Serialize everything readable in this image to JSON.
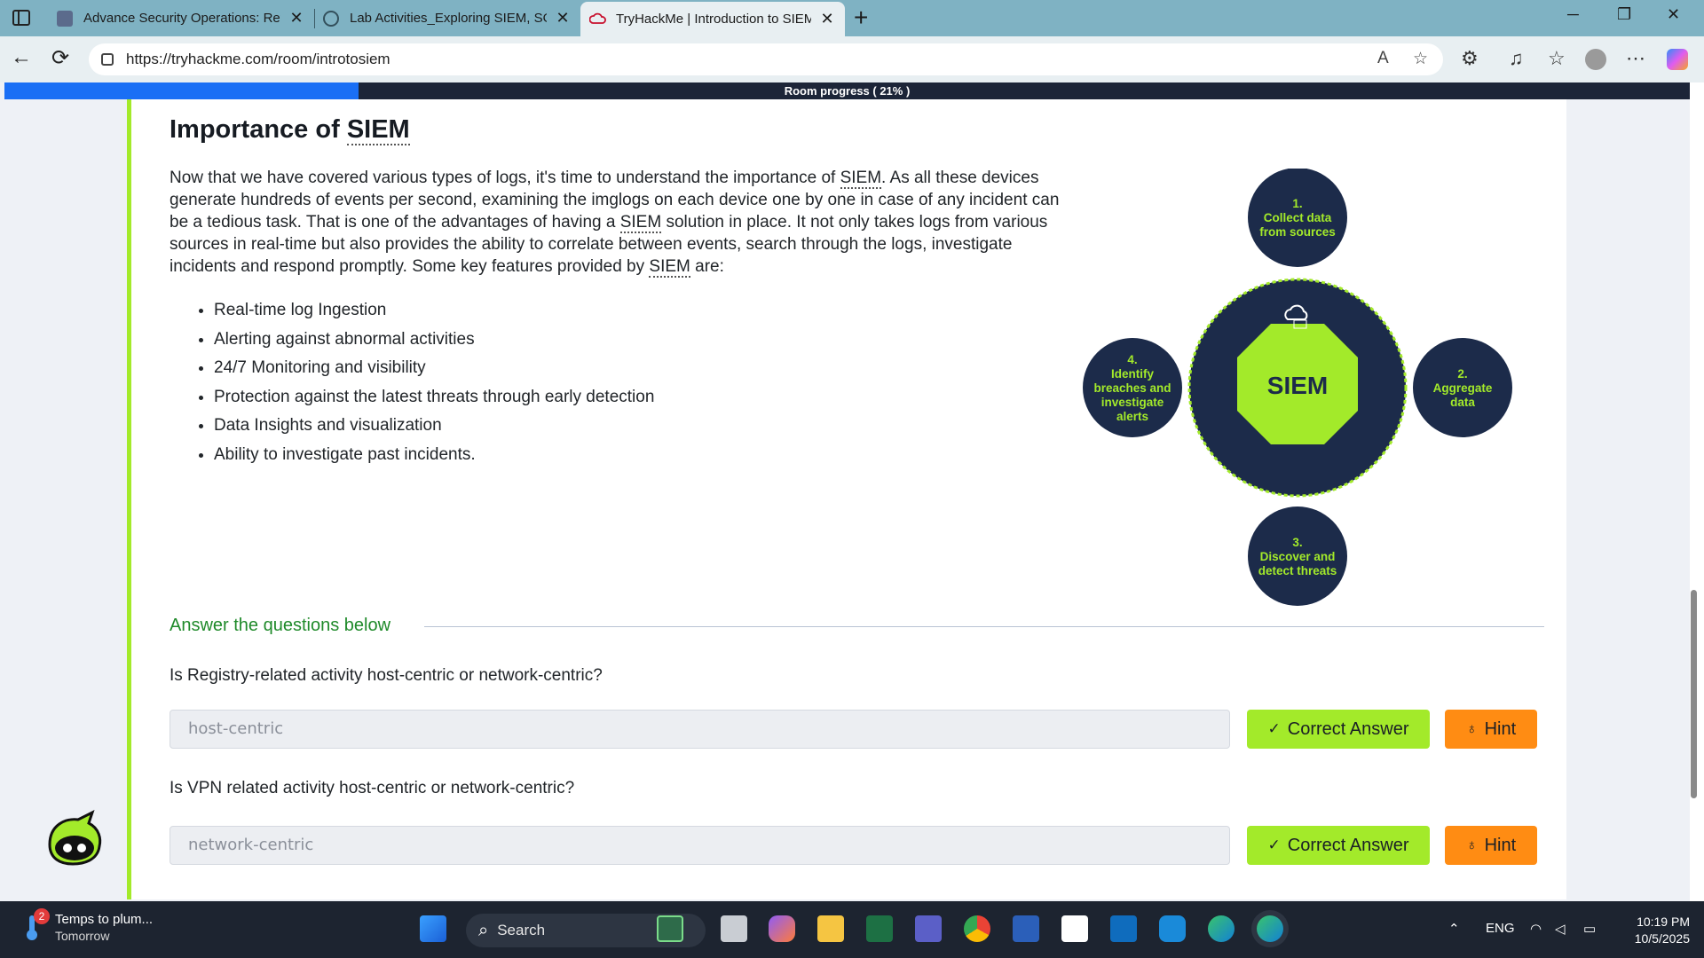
{
  "browser": {
    "tabs": [
      {
        "title": "Advance Security Operations: Ref",
        "favicon": "course-icon",
        "favicon_color": "#5b6b8c",
        "active": false
      },
      {
        "title": "Lab Activities_Exploring SIEM, SO",
        "favicon": "globe-icon",
        "favicon_color": "#33505c",
        "active": false
      },
      {
        "title": "TryHackMe | Introduction to SIEM",
        "favicon": "tryhackme-icon",
        "favicon_color": "#c8102e",
        "active": true
      }
    ],
    "url": "https://tryhackme.com/room/introtosiem"
  },
  "progress": {
    "label": "Room progress ( 21% )",
    "value": 0.21,
    "fill_color": "#1a6ff5"
  },
  "section": {
    "title_prefix": "Importance of ",
    "title_abbr": "SIEM",
    "intro": [
      {
        "t": "Now that we have covered various types of logs, it's time to understand the importance of "
      },
      {
        "t": "SIEM",
        "abbr": true
      },
      {
        "t": ". As all these devices generate hundreds of events per second, examining the imglogs on each device one by one in case of any incident can be a tedious task. That is one of the advantages of having a "
      },
      {
        "t": "SIEM",
        "abbr": true
      },
      {
        "t": " solution in place. It not only takes logs from various sources in real-time but also provides the ability to correlate between events, search through the logs, investigate incidents and respond promptly. Some key features provided by "
      },
      {
        "t": "SIEM",
        "abbr": true
      },
      {
        "t": " are:"
      }
    ],
    "features": [
      "Real-time log Ingestion",
      "Alerting against abnormal activities",
      "24/7 Monitoring and visibility",
      "Protection against the latest threats through early detection",
      "Data Insights and visualization",
      "Ability to investigate past incidents."
    ]
  },
  "diagram": {
    "center_label": "SIEM",
    "colors": {
      "navy": "#1c2b4a",
      "green": "#a3ea2a"
    },
    "steps": [
      {
        "lines": [
          "1.",
          "Collect data",
          "from sources"
        ]
      },
      {
        "lines": [
          "2.",
          "Aggregate",
          "data"
        ]
      },
      {
        "lines": [
          "3.",
          "Discover and",
          "detect threats"
        ]
      },
      {
        "lines": [
          "4.",
          "Identify",
          "breaches and",
          "investigate",
          "alerts"
        ]
      }
    ]
  },
  "questions": {
    "heading": "Answer the questions below",
    "items": [
      {
        "question": "Is Registry-related activity host-centric or network-centric?",
        "answer": "host-centric",
        "correct_label": "Correct Answer",
        "hint_label": "Hint"
      },
      {
        "question": "Is VPN related activity host-centric or network-centric?",
        "answer": "network-centric",
        "correct_label": "Correct Answer",
        "hint_label": "Hint"
      }
    ]
  },
  "taskbar": {
    "weather_title": "Temps to plum...",
    "weather_sub": "Tomorrow",
    "weather_badge": "2",
    "search_label": "Search",
    "apps": [
      "widgets-icon",
      "task-view-icon",
      "copilot-icon",
      "file-explorer-icon",
      "excel-icon",
      "teams-icon",
      "chrome-icon",
      "word-icon",
      "app-icon",
      "outlook-icon",
      "outlook-new-icon",
      "edge-icon",
      "edge-active-icon"
    ],
    "language": "ENG",
    "time": "10:19 PM",
    "date": "10/5/2025"
  }
}
